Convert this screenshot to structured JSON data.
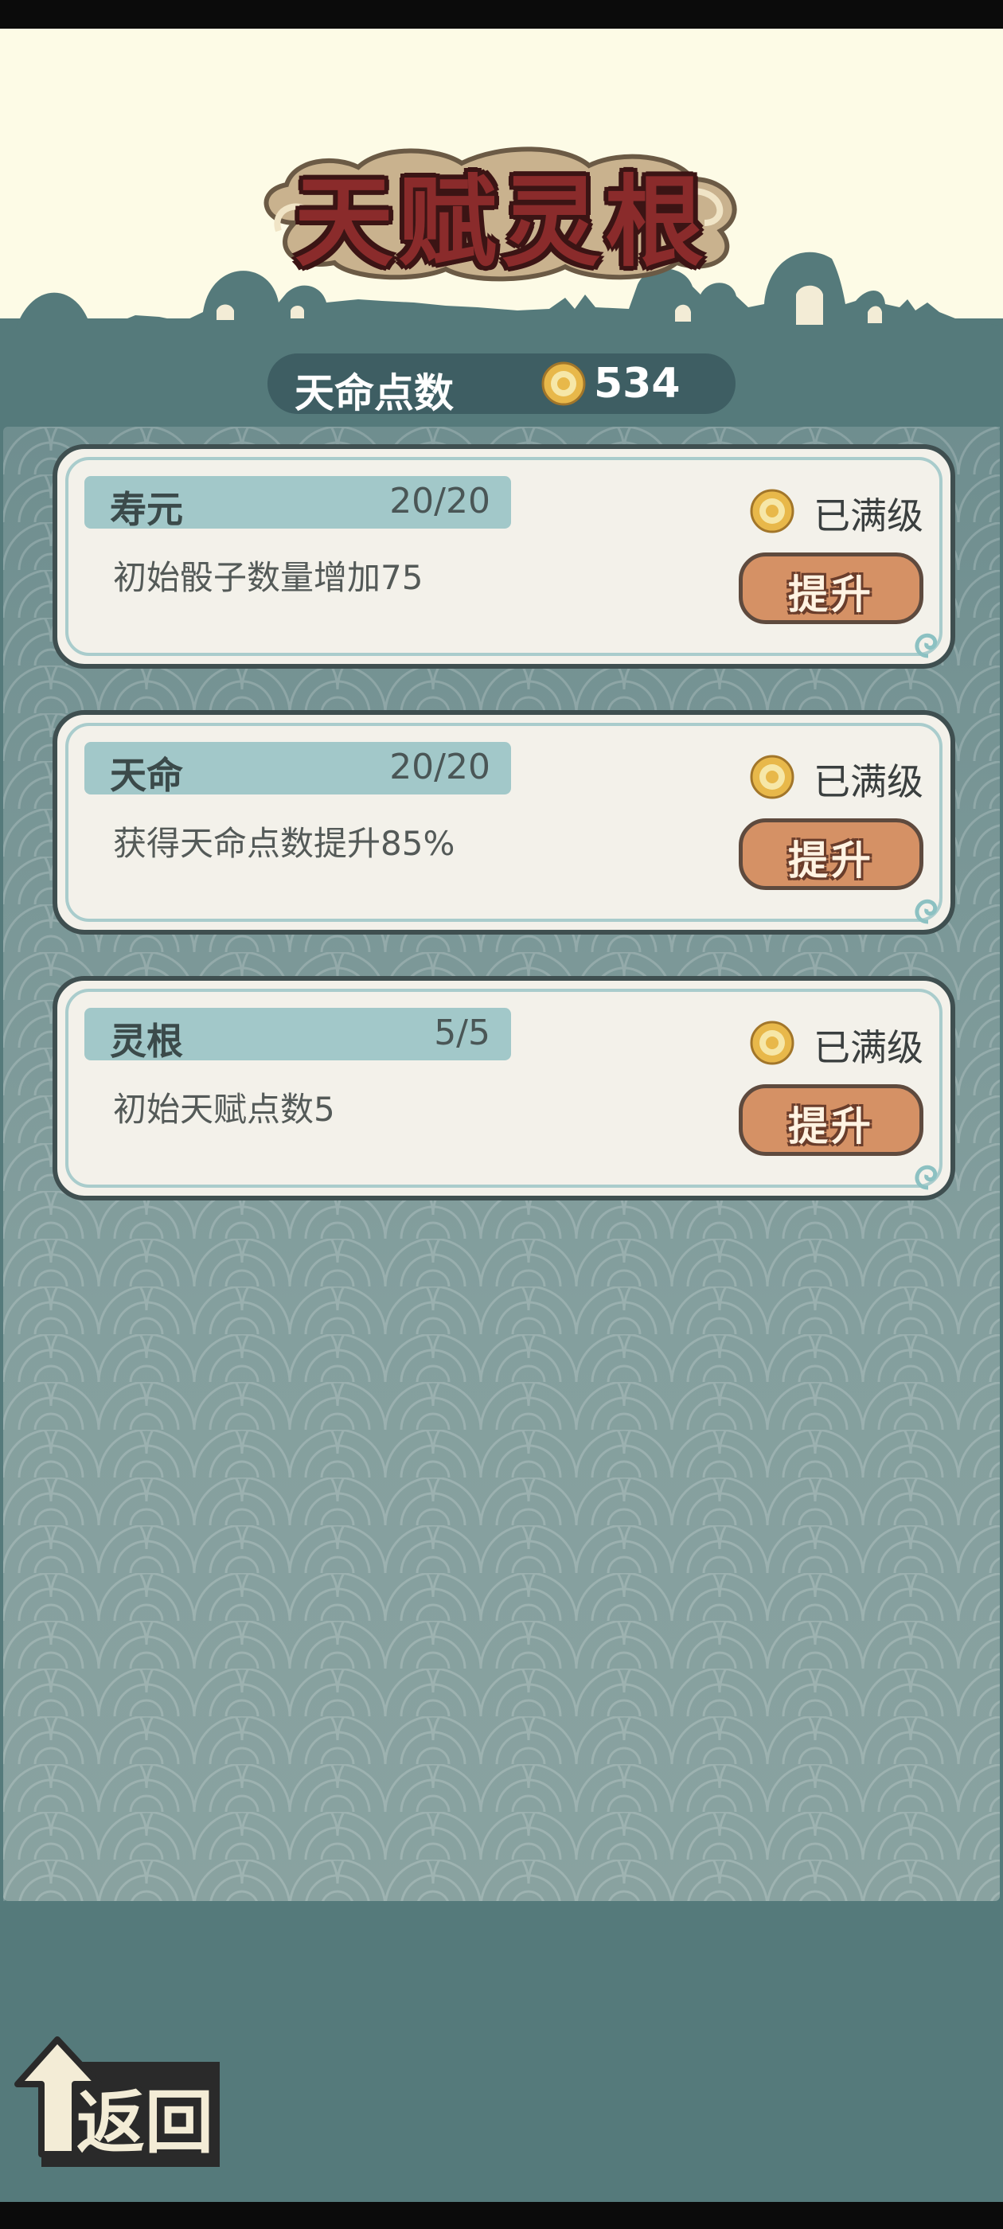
{
  "title": "天赋灵根",
  "points": {
    "label": "天命点数",
    "value": "534",
    "icon": "coin-icon"
  },
  "talents": [
    {
      "name": "寿元",
      "level": "20/20",
      "desc": "初始骰子数量增加75",
      "status": "已满级",
      "button": "提升"
    },
    {
      "name": "天命",
      "level": "20/20",
      "desc": "获得天命点数提升85%",
      "status": "已满级",
      "button": "提升"
    },
    {
      "name": "灵根",
      "level": "5/5",
      "desc": "初始天赋点数5",
      "status": "已满级",
      "button": "提升"
    }
  ],
  "back": {
    "label": "返回",
    "icon": "up-arrow-icon"
  },
  "colors": {
    "sky": "#fdfbe6",
    "ground": "#557a7b",
    "panel": "#849f9e",
    "card": "#f3f1ea",
    "header": "#a2c8c9",
    "button": "#d59165",
    "title": "#8a2b2b"
  }
}
